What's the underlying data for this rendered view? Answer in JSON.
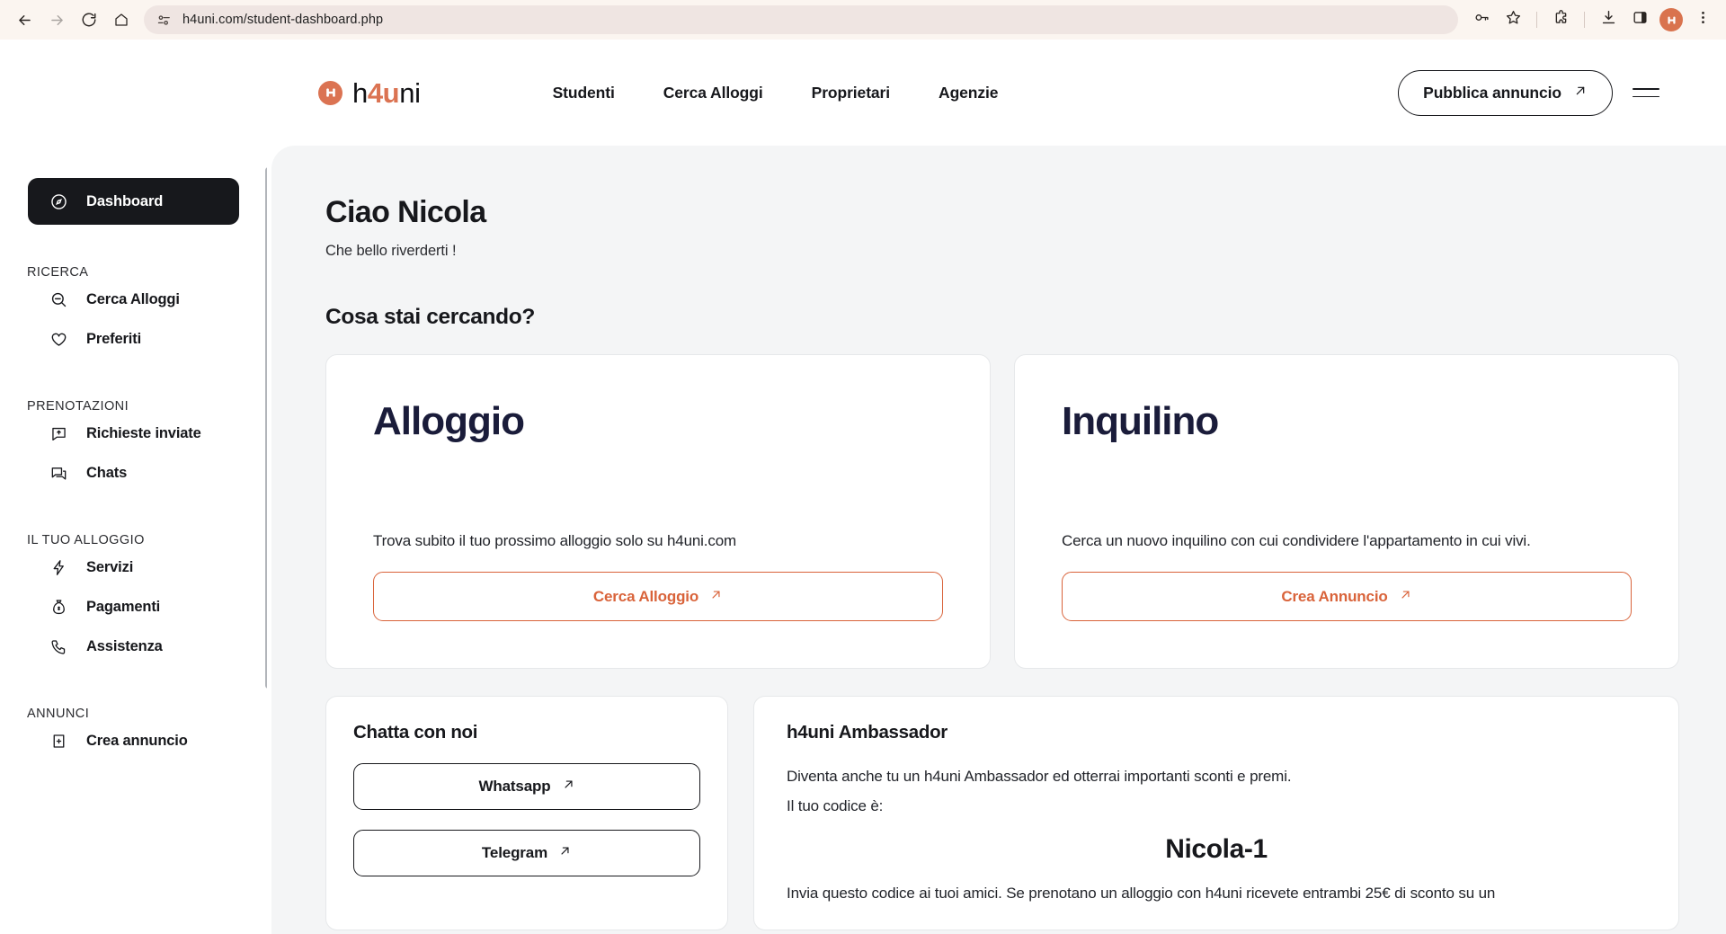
{
  "browser": {
    "url": "h4uni.com/student-dashboard.php",
    "back_icon": "back-arrow-icon",
    "forward_icon": "forward-arrow-icon",
    "reload_icon": "reload-icon",
    "home_icon": "home-icon",
    "site_info_icon": "site-settings-icon",
    "password_icon": "password-key-icon",
    "bookmark_icon": "star-icon",
    "extensions_icon": "puzzle-piece-icon",
    "downloads_icon": "download-icon",
    "side_panel_icon": "side-panel-icon",
    "profile_initial": "H",
    "menu_icon": "three-dot-menu-icon"
  },
  "header": {
    "logo": {
      "prefix": "h",
      "accent": "4u",
      "suffix": "ni",
      "mark": "h4uni-logo-mark"
    },
    "nav": [
      {
        "label": "Studenti"
      },
      {
        "label": "Cerca Alloggi"
      },
      {
        "label": "Proprietari"
      },
      {
        "label": "Agenzie"
      }
    ],
    "cta": {
      "label": "Pubblica annuncio",
      "icon": "arrow-up-right-icon"
    },
    "menu_icon": "hamburger-menu-icon"
  },
  "sidebar": {
    "active": {
      "label": "Dashboard",
      "icon": "compass-icon"
    },
    "groups": [
      {
        "title": "RICERCA",
        "items": [
          {
            "label": "Cerca Alloggi",
            "icon": "search-minus-icon"
          },
          {
            "label": "Preferiti",
            "icon": "heart-icon"
          }
        ]
      },
      {
        "title": "PRENOTAZIONI",
        "items": [
          {
            "label": "Richieste inviate",
            "icon": "message-send-icon"
          },
          {
            "label": "Chats",
            "icon": "chat-bubbles-icon"
          }
        ]
      },
      {
        "title": "IL TUO ALLOGGIO",
        "items": [
          {
            "label": "Servizi",
            "icon": "lightning-bolt-icon"
          },
          {
            "label": "Pagamenti",
            "icon": "money-bag-icon"
          },
          {
            "label": "Assistenza",
            "icon": "phone-icon"
          }
        ]
      },
      {
        "title": "ANNUNCI",
        "items": [
          {
            "label": "Crea annuncio",
            "icon": "document-plus-icon"
          }
        ]
      }
    ]
  },
  "main": {
    "greeting": "Ciao Nicola",
    "subgreeting": "Che bello riverderti !",
    "section_title": "Cosa stai cercando?",
    "cards": [
      {
        "title": "Alloggio",
        "description": "Trova subito il tuo prossimo alloggio solo su h4uni.com",
        "button": "Cerca Alloggio",
        "button_icon": "arrow-up-right-icon"
      },
      {
        "title": "Inquilino",
        "description": "Cerca un nuovo inquilino con cui condividere l'appartamento in cui vivi.",
        "button": "Crea Annuncio",
        "button_icon": "arrow-up-right-icon"
      }
    ],
    "chat_card": {
      "title": "Chatta con noi",
      "buttons": [
        {
          "label": "Whatsapp",
          "icon": "arrow-up-right-icon"
        },
        {
          "label": "Telegram",
          "icon": "arrow-up-right-icon"
        }
      ]
    },
    "ambassador": {
      "title": "h4uni Ambassador",
      "intro": "Diventa anche tu un h4uni Ambassador ed otterrai importanti sconti e premi.",
      "code_label": "Il tuo codice è:",
      "code": "Nicola-1",
      "footer": "Invia questo codice ai tuoi amici. Se prenotano un alloggio con h4uni ricevete entrambi 25€ di sconto su un"
    }
  },
  "colors": {
    "accent_orange": "#DB7352",
    "button_orange": "#D9633A",
    "ink": "#17181C",
    "navy": "#1A1C3A",
    "panel_bg": "#F4F5F6",
    "browser_bg": "#FBF5F0"
  }
}
